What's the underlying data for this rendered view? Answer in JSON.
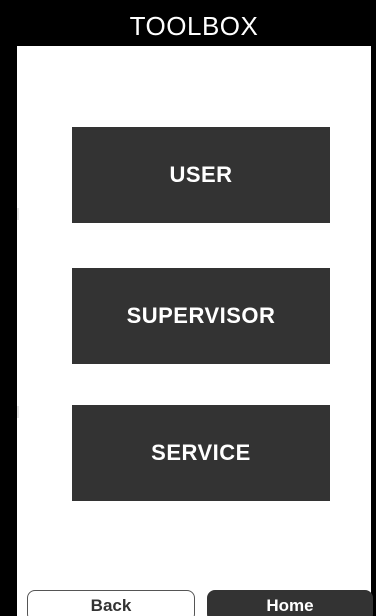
{
  "header": {
    "title": "TOOLBOX"
  },
  "menu": {
    "buttons": [
      {
        "label": "USER"
      },
      {
        "label": "SUPERVISOR"
      },
      {
        "label": "SERVICE"
      }
    ]
  },
  "footer": {
    "back_label": "Back",
    "home_label": "Home"
  },
  "colors": {
    "frame": "#000000",
    "button_fill": "#333333",
    "button_text": "#ffffff",
    "background": "#ffffff"
  }
}
